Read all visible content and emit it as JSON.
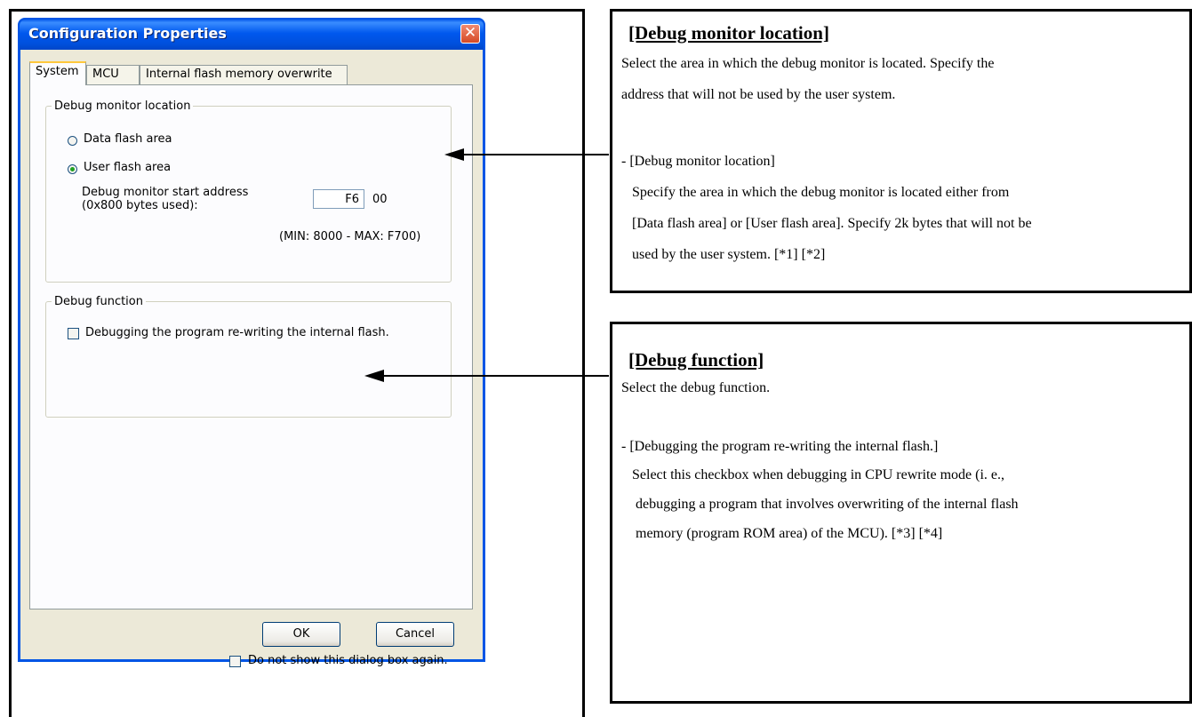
{
  "dialog": {
    "title": "Configuration Properties",
    "close_glyph": "✕",
    "tabs": [
      "System",
      "MCU",
      "Internal flash memory overwrite"
    ],
    "debug_monitor_group": {
      "legend": "Debug monitor location",
      "options": [
        "Data flash area",
        "User flash area"
      ],
      "selected_option": "User flash area",
      "start_address_label_line1": "Debug monitor start address",
      "start_address_label_line2": "(0x800 bytes used):",
      "start_address_value": "F6",
      "start_address_suffix": "00",
      "range_text": "(MIN: 8000 - MAX: F700)"
    },
    "debug_function_group": {
      "legend": "Debug function",
      "checkbox_label": "Debugging the program re-writing the internal flash.",
      "checked": false
    },
    "ok_label": "OK",
    "cancel_label": "Cancel",
    "dont_show_label": "Do not show this dialog box again."
  },
  "desc_monitor": {
    "title": "[Debug monitor location]",
    "para1_line1": "Select the area in which the debug monitor is located. Specify the",
    "para1_line2": "address that will not be used by the user system.",
    "item_title": "- [Debug monitor location]",
    "item_line1": "Specify the area in which the debug monitor is located either from",
    "item_line2": "[Data flash area] or [User flash area]. Specify 2k bytes that will not be",
    "item_line3": "used by the user system. [*1] [*2]"
  },
  "desc_function": {
    "title": "[Debug function]",
    "para1": "Select the debug function.",
    "item_title": "- [Debugging the program re-writing the internal flash.]",
    "item_line1": "Select this checkbox when debugging in CPU rewrite mode (i. e.,",
    "item_line2": "debugging a program that involves overwriting of the internal flash",
    "item_line3": "memory (program ROM area) of the MCU). [*3] [*4]"
  }
}
